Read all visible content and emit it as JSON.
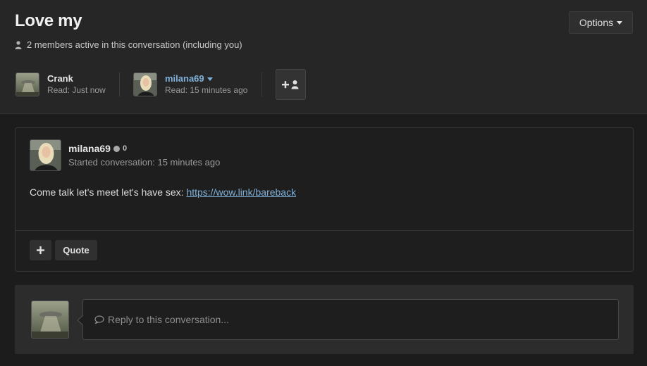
{
  "conversation": {
    "title": "Love my",
    "members_active": "2 members active in this conversation (including you)",
    "options_label": "Options"
  },
  "participants": [
    {
      "name": "Crank",
      "read": "Read: Just now"
    },
    {
      "name": "milana69",
      "read": "Read: 15 minutes ago"
    }
  ],
  "message": {
    "author": "milana69",
    "reaction_count": "0",
    "started": "Started conversation: 15 minutes ago",
    "body_text": "Come talk let's meet let's have sex: ",
    "link_text": "https://wow.link/bareback",
    "quote_label": "Quote"
  },
  "reply": {
    "placeholder": "Reply to this conversation..."
  },
  "colors": {
    "background": "#1c1c1c",
    "header_bg": "#262626",
    "link": "#7fb0d8",
    "text": "#dcdcdc",
    "muted": "#9a9a9a"
  },
  "icons": [
    "user-icon",
    "caret-down-icon",
    "add-member-icon",
    "plus-icon",
    "comment-icon",
    "status-dot-icon"
  ]
}
